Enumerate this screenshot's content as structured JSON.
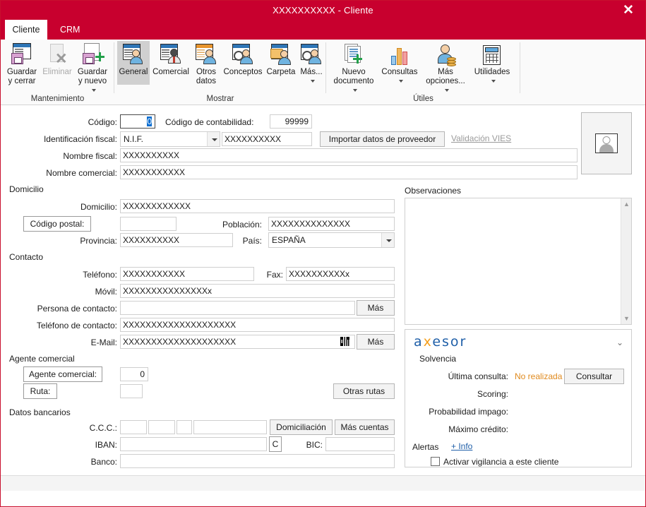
{
  "window": {
    "title": "XXXXXXXXXX - Cliente",
    "close_label": "✕",
    "accent_color": "#c8002e"
  },
  "tabs": [
    {
      "label": "Cliente",
      "active": true
    },
    {
      "label": "CRM",
      "active": false
    }
  ],
  "ribbon": {
    "groups": [
      {
        "name": "Mantenimiento",
        "label": "Mantenimiento",
        "items": [
          {
            "label": "Guardar\ny cerrar",
            "icon": "save-close-icon",
            "disabled": false,
            "caret": false
          },
          {
            "label": "Eliminar",
            "icon": "delete-icon",
            "disabled": true,
            "caret": false
          },
          {
            "label": "Guardar\ny nuevo",
            "icon": "save-new-icon",
            "disabled": false,
            "caret": true
          }
        ]
      },
      {
        "name": "Mostrar",
        "label": "Mostrar",
        "items": [
          {
            "label": "General",
            "icon": "general-icon",
            "selected": true,
            "caret": false
          },
          {
            "label": "Comercial",
            "icon": "comercial-icon",
            "selected": false,
            "caret": false
          },
          {
            "label": "Otros\ndatos",
            "icon": "otros-datos-icon",
            "selected": false,
            "caret": false
          },
          {
            "label": "Conceptos",
            "icon": "conceptos-icon",
            "selected": false,
            "caret": false
          },
          {
            "label": "Carpeta",
            "icon": "carpeta-icon",
            "selected": false,
            "caret": false
          },
          {
            "label": "Más...",
            "icon": "mas-icon",
            "selected": false,
            "caret": true
          }
        ]
      },
      {
        "name": "Útiles",
        "label": "Útiles",
        "items": [
          {
            "label": "Nuevo\ndocumento",
            "icon": "nuevo-documento-icon",
            "caret": true
          },
          {
            "label": "Consultas",
            "icon": "consultas-icon",
            "caret": true
          },
          {
            "label": "Más\nopciones...",
            "icon": "mas-opciones-icon",
            "caret": true
          },
          {
            "label": "Utilidades",
            "icon": "utilidades-icon",
            "caret": true
          }
        ]
      }
    ]
  },
  "form": {
    "codigo": {
      "label": "Código:",
      "value": "0",
      "contabilidad_label": "Código de contabilidad:",
      "contabilidad_value": "99999"
    },
    "identificacion_fiscal": {
      "label": "Identificación fiscal:",
      "type_value": "N.I.F.",
      "number_value": "XXXXXXXXXX",
      "import_button": "Importar datos de proveedor",
      "vies_link": "Validación VIES"
    },
    "nombre_fiscal": {
      "label": "Nombre fiscal:",
      "value": "XXXXXXXXXX"
    },
    "nombre_comercial": {
      "label": "Nombre comercial:",
      "value": "XXXXXXXXXXX"
    },
    "domicilio_section": {
      "header": "Domicilio",
      "domicilio_label": "Domicilio:",
      "domicilio_value": "XXXXXXXXXXXX",
      "codigo_postal_label": "Código postal:",
      "codigo_postal_value": "",
      "poblacion_label": "Población:",
      "poblacion_value": "XXXXXXXXXXXXXX",
      "provincia_label": "Provincia:",
      "provincia_value": "XXXXXXXXXX",
      "pais_label": "País:",
      "pais_value": "ESPAÑA"
    },
    "contacto_section": {
      "header": "Contacto",
      "telefono_label": "Teléfono:",
      "telefono_value": "XXXXXXXXXXX",
      "fax_label": "Fax:",
      "fax_value": "XXXXXXXXXXx",
      "movil_label": "Móvil:",
      "movil_value": "XXXXXXXXXXXXXXXx",
      "persona_label": "Persona de contacto:",
      "persona_value": "",
      "persona_mas_button": "Más",
      "telefono_contacto_label": "Teléfono de contacto:",
      "telefono_contacto_value": "XXXXXXXXXXXXXXXXXXXX",
      "email_label": "E-Mail:",
      "email_value": "XXXXXXXXXXXXXXXXXXXX",
      "email_mas_button": "Más"
    },
    "agente_section": {
      "header": "Agente comercial",
      "agente_label": "Agente comercial:",
      "agente_value": "0",
      "ruta_label": "Ruta:",
      "ruta_value": "",
      "otras_rutas_button": "Otras rutas"
    },
    "bancarios_section": {
      "header": "Datos bancarios",
      "ccc_label": "C.C.C.:",
      "ccc_entidad": "",
      "ccc_oficina": "",
      "ccc_dc": "",
      "ccc_cuenta": "",
      "domiciliacion_button": "Domiciliación",
      "mas_cuentas_button": "Más cuentas",
      "iban_label": "IBAN:",
      "iban_value": "",
      "iban_calc_button": "C",
      "bic_label": "BIC:",
      "bic_value": "",
      "banco_label": "Banco:",
      "banco_value": ""
    },
    "observaciones": {
      "label": "Observaciones",
      "value": ""
    },
    "avatar": {
      "name": "client-photo-placeholder"
    },
    "axesor": {
      "logo_a": "a",
      "logo_x": "x",
      "logo_rest": "esor",
      "collapse_icon": "⌄",
      "solvencia_header": "Solvencia",
      "ultima_consulta_label": "Última consulta:",
      "ultima_consulta_value": "No realizada",
      "ultima_consulta_color": "#e08a1e",
      "consultar_button": "Consultar",
      "scoring_label": "Scoring:",
      "scoring_value": "",
      "probabilidad_label": "Probabilidad impago:",
      "probabilidad_value": "",
      "maximo_credito_label": "Máximo crédito:",
      "maximo_credito_value": "",
      "alertas_label": "Alertas",
      "info_link": "+ Info",
      "vigilancia_label": "Activar vigilancia a este cliente",
      "vigilancia_checked": false
    }
  }
}
